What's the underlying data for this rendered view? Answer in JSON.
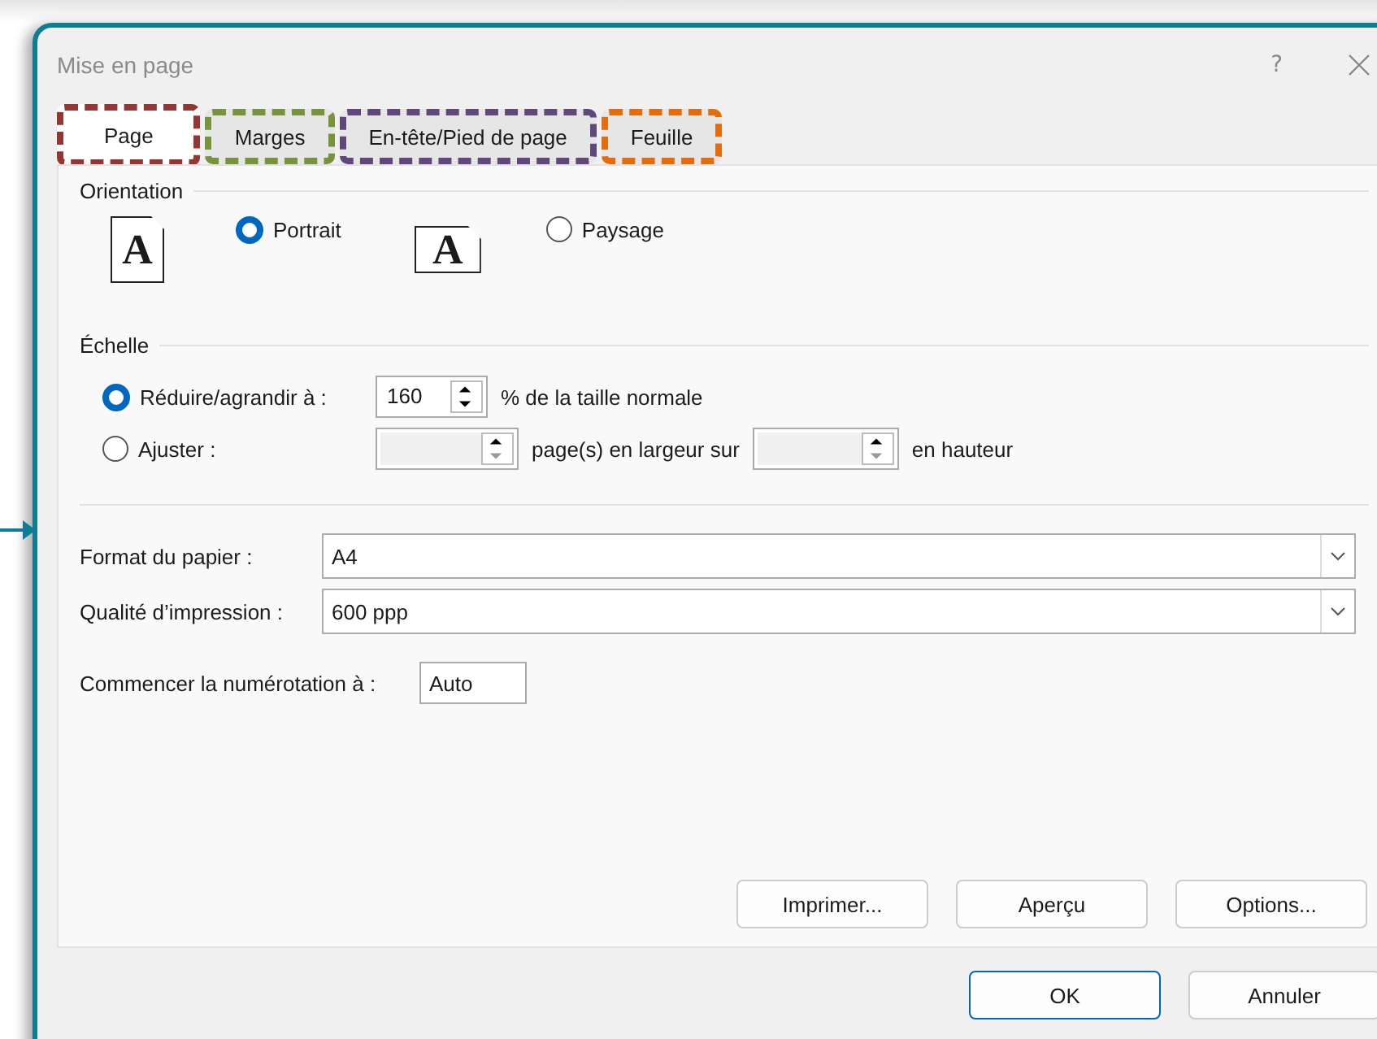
{
  "window": {
    "title": "Mise en page",
    "help": "?"
  },
  "tabs": [
    {
      "label": "Page",
      "selected": true,
      "color": "#943634"
    },
    {
      "label": "Marges",
      "selected": false,
      "color": "#77933c"
    },
    {
      "label": "En-tête/Pied de page",
      "selected": false,
      "color": "#60497a"
    },
    {
      "label": "Feuille",
      "selected": false,
      "color": "#e46c0a"
    }
  ],
  "orientation": {
    "legend": "Orientation",
    "options": [
      {
        "kind": "portrait",
        "label": "Portrait",
        "selected": true,
        "icon_letter": "A"
      },
      {
        "kind": "landscape",
        "label": "Paysage",
        "selected": false,
        "icon_letter": "A"
      }
    ]
  },
  "scale": {
    "legend": "Échelle",
    "options": [
      {
        "kind": "percent",
        "label": "Réduire/agrandir à :",
        "selected": true,
        "value": "160",
        "suffix": "% de la taille normale"
      },
      {
        "kind": "fit",
        "label": "Ajuster :",
        "selected": false,
        "width_suffix": "page(s) en largeur sur",
        "height_suffix": "en hauteur"
      }
    ]
  },
  "paper": [
    {
      "label": "Format du papier :",
      "value": "A4"
    },
    {
      "label": "Qualité d’impression :",
      "value": "600 ppp"
    }
  ],
  "start_number": {
    "label": "Commencer la numérotation à :",
    "value": "Auto"
  },
  "buttons": [
    "Imprimer...",
    "Aperçu",
    "Options..."
  ],
  "footer": [
    {
      "label": "OK",
      "default": true
    },
    {
      "label": "Annuler",
      "default": false
    }
  ]
}
